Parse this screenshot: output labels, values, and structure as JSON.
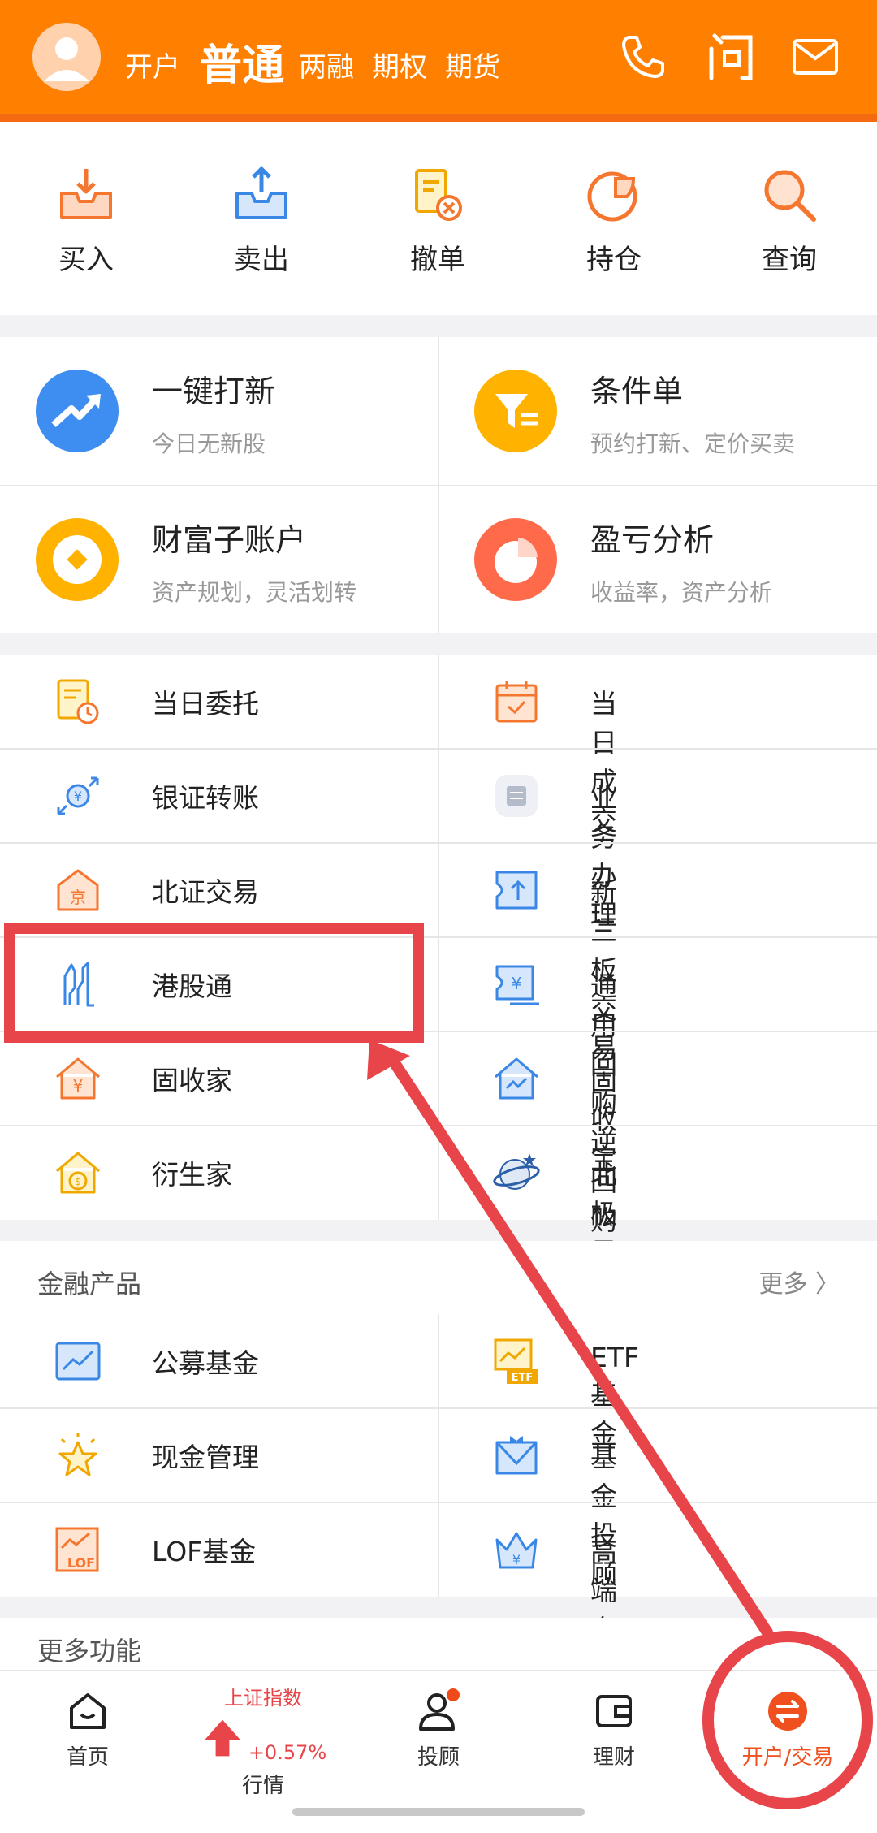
{
  "header": {
    "tabs": [
      {
        "label": "开户"
      },
      {
        "label": "普通"
      },
      {
        "label": "两融"
      },
      {
        "label": "期权"
      },
      {
        "label": "期货"
      }
    ],
    "icons": [
      "phone-icon",
      "question-icon",
      "mail-icon"
    ],
    "background_color": "#ff7f00"
  },
  "quick_actions": [
    {
      "label": "买入",
      "icon": "buy-inbox-icon"
    },
    {
      "label": "卖出",
      "icon": "sell-outbox-icon"
    },
    {
      "label": "撤单",
      "icon": "cancel-order-icon"
    },
    {
      "label": "持仓",
      "icon": "position-pie-icon"
    },
    {
      "label": "查询",
      "icon": "search-icon"
    }
  ],
  "feature_cards": [
    {
      "title": "一键打新",
      "subtitle": "今日无新股",
      "icon": "ipo-arrow-icon",
      "color": "#3d8ef0"
    },
    {
      "title": "条件单",
      "subtitle": "预约打新、定价买卖",
      "icon": "filter-funnel-icon",
      "color": "#ffb300"
    },
    {
      "title": "财富子账户",
      "subtitle": "资产规划，灵活划转",
      "icon": "coin-icon",
      "color": "#ffb300"
    },
    {
      "title": "盈亏分析",
      "subtitle": "收益率，资产分析",
      "icon": "pie-chart-icon",
      "color": "#ff6a4a"
    }
  ],
  "functions": [
    {
      "label": "当日委托",
      "icon": "daily-entrust-icon"
    },
    {
      "label": "当日成交",
      "icon": "daily-deal-icon"
    },
    {
      "label": "银证转账",
      "icon": "bank-transfer-icon"
    },
    {
      "label": "业务办理",
      "icon": "business-icon"
    },
    {
      "label": "北证交易",
      "icon": "beijing-exchange-icon"
    },
    {
      "label": "新三板交易",
      "icon": "neeq-icon"
    },
    {
      "label": "港股通",
      "icon": "hk-connect-icon"
    },
    {
      "label": "通用回购逆回购",
      "icon": "repo-icon"
    },
    {
      "label": "固收家",
      "icon": "fixed-income-home-icon"
    },
    {
      "label": "固收宝",
      "icon": "fixed-income-treasure-icon"
    },
    {
      "label": "衍生家",
      "icon": "derivatives-icon"
    },
    {
      "label": "北极星账户诊断",
      "icon": "polaris-icon"
    }
  ],
  "financial_products": {
    "title": "金融产品",
    "more_label": "更多 〉",
    "items": [
      {
        "label": "公募基金",
        "icon": "mutual-fund-icon"
      },
      {
        "label": "ETF基金",
        "icon": "etf-fund-icon"
      },
      {
        "label": "现金管理",
        "icon": "cash-star-icon"
      },
      {
        "label": "基金投顾",
        "icon": "fund-advisor-icon"
      },
      {
        "label": "LOF基金",
        "icon": "lof-fund-icon"
      },
      {
        "label": "高端专区",
        "icon": "premium-crown-icon"
      }
    ]
  },
  "more_functions": {
    "title": "更多功能"
  },
  "bottom_nav": [
    {
      "label": "首页",
      "icon": "home-icon"
    },
    {
      "label": "行情",
      "index_name": "上证指数",
      "index_change": "+0.57%",
      "icon": "up-arrow-icon"
    },
    {
      "label": "投顾",
      "icon": "advisor-person-icon"
    },
    {
      "label": "理财",
      "icon": "wallet-icon"
    },
    {
      "label": "开户/交易",
      "icon": "exchange-icon",
      "active": true
    }
  ],
  "colors": {
    "accent": "#ff7f00",
    "annotation": "#e8454a",
    "index_up": "#e8454a"
  }
}
